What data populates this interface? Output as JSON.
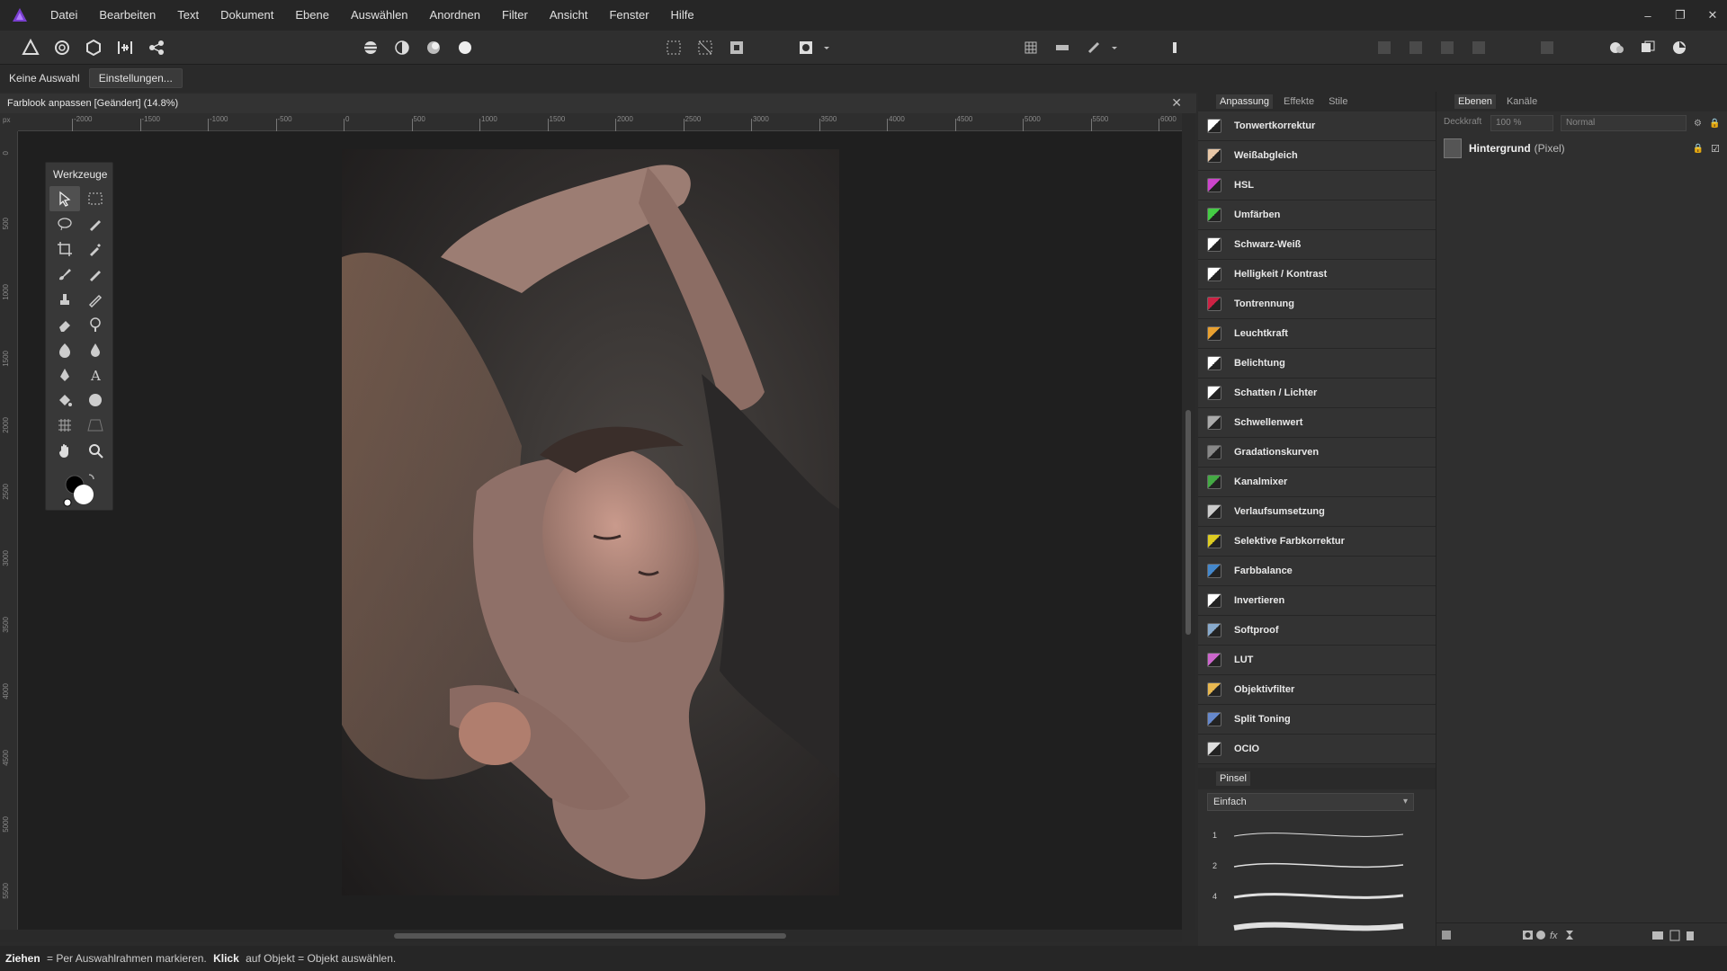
{
  "menubar": {
    "items": [
      "Datei",
      "Bearbeiten",
      "Text",
      "Dokument",
      "Ebene",
      "Auswählen",
      "Anordnen",
      "Filter",
      "Ansicht",
      "Fenster",
      "Hilfe"
    ]
  },
  "context_bar": {
    "selection_label": "Keine Auswahl",
    "settings_button": "Einstellungen..."
  },
  "document": {
    "title": "Farblook anpassen [Geändert] (14.8%)"
  },
  "ruler": {
    "unit": "px",
    "top_ticks": [
      "-2000",
      "-1500",
      "-1000",
      "-500",
      "0",
      "500",
      "1000",
      "1500",
      "2000",
      "2500",
      "3000",
      "3500",
      "4000",
      "4500",
      "5000",
      "5500",
      "6000"
    ],
    "left_ticks": [
      "0",
      "500",
      "1000",
      "1500",
      "2000",
      "2500",
      "3000",
      "3500",
      "4000",
      "4500",
      "5000",
      "5500"
    ]
  },
  "tools_panel": {
    "title": "Werkzeuge"
  },
  "adjustment_panel": {
    "tabs": [
      "Anpassung",
      "Effekte",
      "Stile"
    ],
    "items": [
      {
        "label": "Tonwertkorrektur",
        "icon": "levels-icon",
        "color": "#ffffff"
      },
      {
        "label": "Weißabgleich",
        "icon": "white-balance-icon",
        "color": "#e8c8a8"
      },
      {
        "label": "HSL",
        "icon": "hsl-icon",
        "color": "#cc44cc"
      },
      {
        "label": "Umfärben",
        "icon": "recolor-icon",
        "color": "#44cc44"
      },
      {
        "label": "Schwarz-Weiß",
        "icon": "black-white-icon",
        "color": "#ffffff"
      },
      {
        "label": "Helligkeit / Kontrast",
        "icon": "brightness-contrast-icon",
        "color": "#ffffff"
      },
      {
        "label": "Tontrennung",
        "icon": "posterize-icon",
        "color": "#cc2244"
      },
      {
        "label": "Leuchtkraft",
        "icon": "vibrance-icon",
        "color": "#e8a030"
      },
      {
        "label": "Belichtung",
        "icon": "exposure-icon",
        "color": "#ffffff"
      },
      {
        "label": "Schatten / Lichter",
        "icon": "shadows-highlights-icon",
        "color": "#ffffff"
      },
      {
        "label": "Schwellenwert",
        "icon": "threshold-icon",
        "color": "#aaaaaa"
      },
      {
        "label": "Gradationskurven",
        "icon": "curves-icon",
        "color": "#888888"
      },
      {
        "label": "Kanalmixer",
        "icon": "channel-mixer-icon",
        "color": "#44aa44"
      },
      {
        "label": "Verlaufsumsetzung",
        "icon": "gradient-map-icon",
        "color": "#cccccc"
      },
      {
        "label": "Selektive Farbkorrektur",
        "icon": "selective-color-icon",
        "color": "#ddcc22"
      },
      {
        "label": "Farbbalance",
        "icon": "color-balance-icon",
        "color": "#4488cc"
      },
      {
        "label": "Invertieren",
        "icon": "invert-icon",
        "color": "#ffffff"
      },
      {
        "label": "Softproof",
        "icon": "softproof-icon",
        "color": "#88aacc"
      },
      {
        "label": "LUT",
        "icon": "lut-icon",
        "color": "#cc66cc"
      },
      {
        "label": "Objektivfilter",
        "icon": "lens-filter-icon",
        "color": "#e8b850"
      },
      {
        "label": "Split Toning",
        "icon": "split-toning-icon",
        "color": "#6688cc"
      },
      {
        "label": "OCIO",
        "icon": "ocio-icon",
        "color": "#dddddd"
      }
    ]
  },
  "brush_panel": {
    "tab": "Pinsel",
    "category": "Einfach",
    "sizes": [
      "1",
      "2",
      "4",
      ""
    ]
  },
  "layers_panel": {
    "tabs": [
      "Ebenen",
      "Kanäle"
    ],
    "opacity_label": "Deckkraft",
    "opacity": "100 %",
    "blend_mode": "Normal",
    "layers": [
      {
        "name": "Hintergrund",
        "type": "(Pixel)"
      }
    ]
  },
  "status": {
    "drag_key": "Ziehen",
    "drag_text": " = Per Auswahlrahmen markieren. ",
    "click_key": "Klick",
    "click_text": " auf Objekt = Objekt auswählen."
  }
}
